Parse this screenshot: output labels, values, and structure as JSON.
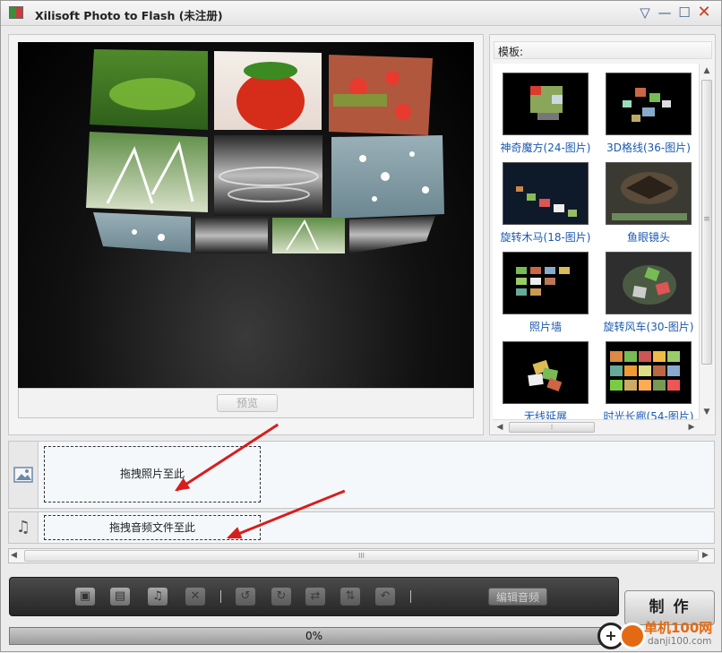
{
  "window": {
    "title": "Xilisoft Photo to Flash (未注册)",
    "controls": {
      "menu": "▽",
      "minimize": "—",
      "maximize": "☐",
      "close": "✕"
    }
  },
  "preview": {
    "button_label": "预览"
  },
  "templates": {
    "header": "模板:",
    "items": [
      {
        "label": "神奇魔方(24-图片)"
      },
      {
        "label": "3D格线(36-图片)"
      },
      {
        "label": "旋转木马(18-图片)"
      },
      {
        "label": "鱼眼镜头"
      },
      {
        "label": "照片墙"
      },
      {
        "label": "旋转风车(30-图片)"
      },
      {
        "label": "无线延展"
      },
      {
        "label": "时光长廊(54-图片)"
      }
    ],
    "scroll_grip": "≡",
    "hscroll_grip": "⁞"
  },
  "tracks": {
    "photo_drop_label": "拖拽照片至此",
    "audio_drop_label": "拖拽音频文件至此",
    "photo_icon": "image-icon",
    "audio_icon": "music-note-icon",
    "timeline_grip": "III"
  },
  "toolbar": {
    "edit_audio_label": "编辑音频",
    "icons": [
      "add-image-icon",
      "add-folder-icon",
      "add-music-icon",
      "delete-icon",
      "rotate-left-icon",
      "rotate-right-icon",
      "swap-icon",
      "move-updown-icon",
      "undo-icon"
    ]
  },
  "make_button": "制 作",
  "progress": {
    "text": "0%",
    "value": 0
  },
  "watermark": {
    "text": "单机100网",
    "url": "danji100.com"
  },
  "colors": {
    "accent_link": "#1a59b0",
    "arrow_red": "#d81d1d",
    "watermark_orange": "#e36a12"
  }
}
